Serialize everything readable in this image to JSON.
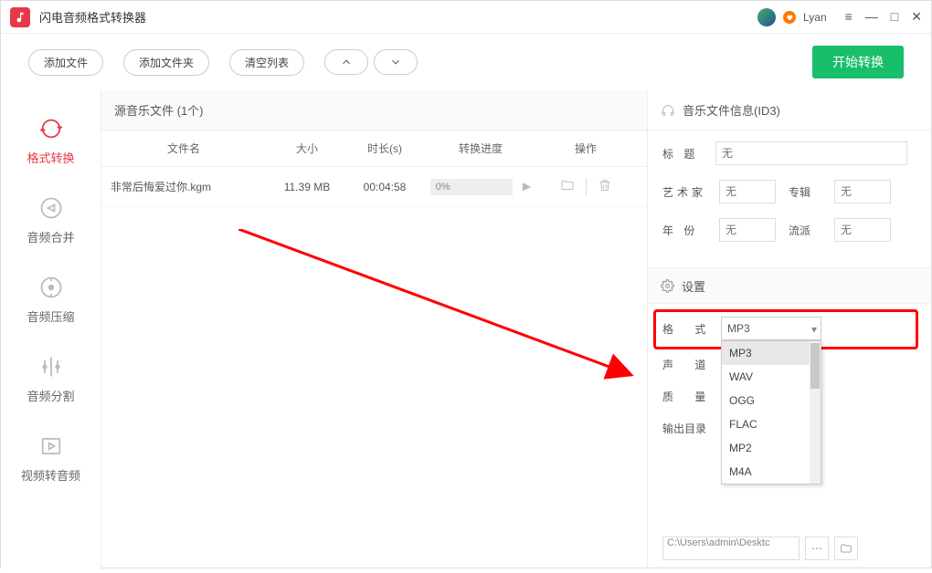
{
  "titlebar": {
    "app_name": "闪电音频格式转换器",
    "username": "Lyan"
  },
  "toolbar": {
    "add_file": "添加文件",
    "add_folder": "添加文件夹",
    "clear_list": "清空列表",
    "start": "开始转换"
  },
  "sidebar": {
    "format_convert": "格式转换",
    "audio_merge": "音频合并",
    "audio_compress": "音频压缩",
    "audio_split": "音频分割",
    "video_to_audio": "视频转音频"
  },
  "file_list": {
    "heading": "源音乐文件 (1个)",
    "cols": {
      "name": "文件名",
      "size": "大小",
      "dur": "时长(s)",
      "prog": "转换进度",
      "ops": "操作"
    },
    "rows": [
      {
        "name": "非常后悔爱过你.kgm",
        "size": "11.39 MB",
        "dur": "00:04:58",
        "prog": "0%"
      }
    ]
  },
  "id3": {
    "heading": "音乐文件信息(ID3)",
    "labels": {
      "title": "标  题",
      "artist": "艺术家",
      "album": "专辑",
      "year": "年  份",
      "genre": "流派"
    },
    "placeholder": "无"
  },
  "settings": {
    "heading": "设置",
    "labels": {
      "format": "格   式",
      "channel": "声   道",
      "quality": "质   量",
      "output": "输出目录"
    },
    "format_value": "MP3",
    "format_options": [
      "MP3",
      "WAV",
      "OGG",
      "FLAC",
      "MP2",
      "M4A"
    ],
    "output_path": "C:\\Users\\admin\\Desktc"
  }
}
